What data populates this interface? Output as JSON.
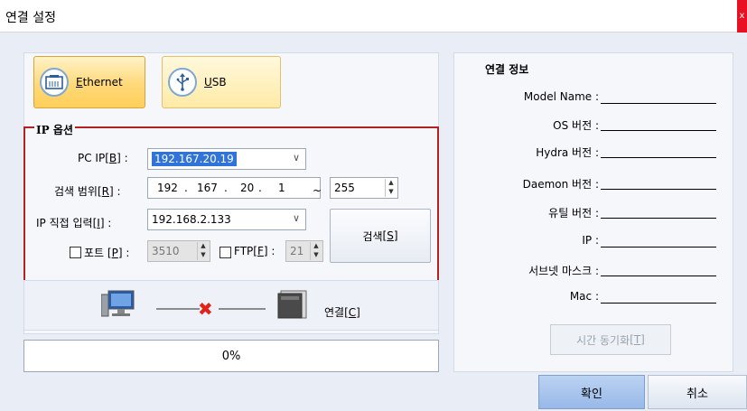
{
  "window": {
    "title": "연결 설정",
    "close_label": "x"
  },
  "modes": {
    "ethernet": {
      "accel": "E",
      "label_rest": "thernet",
      "icon": "ethernet-port-icon"
    },
    "usb": {
      "accel": "U",
      "label_rest": "SB",
      "icon": "usb-icon"
    }
  },
  "ip_options": {
    "title": "IP 옵션",
    "pc_ip": {
      "label": "PC IP",
      "accel": "B",
      "value": "192.167.20.19"
    },
    "search_range": {
      "label": "검색 범위",
      "accel": "R",
      "oct1": "192",
      "oct2": "167",
      "oct3": "20",
      "oct4": "1",
      "sep": "~",
      "end": "255"
    },
    "direct_ip": {
      "label": "IP 직접 입력",
      "accel": "I",
      "value": "192.168.2.133"
    },
    "port": {
      "label": "포트",
      "accel": "P",
      "value": "3510",
      "checked": false
    },
    "ftp": {
      "label": "FTP",
      "accel": "F",
      "value": "21",
      "checked": false
    },
    "search_button": {
      "label": "검색",
      "accel": "S"
    }
  },
  "connection": {
    "button_label": "연결",
    "accel": "C",
    "status_icon": "disconnected-x-icon"
  },
  "progress": {
    "text": "0%",
    "value": 0
  },
  "info": {
    "title": "연결 정보",
    "rows": [
      {
        "label": "Model Name :"
      },
      {
        "label": "OS 버전 :"
      },
      {
        "label": "Hydra 버전 :"
      },
      {
        "label": "Daemon 버전 :"
      },
      {
        "label": "유틸 버전 :"
      },
      {
        "label": "IP :"
      },
      {
        "label": "서브넷 마스크 :"
      },
      {
        "label": "Mac :"
      }
    ],
    "sync_button": {
      "label": "시간 동기화",
      "accel": "T"
    }
  },
  "footer": {
    "ok_label": "확인",
    "cancel_label": "취소"
  }
}
